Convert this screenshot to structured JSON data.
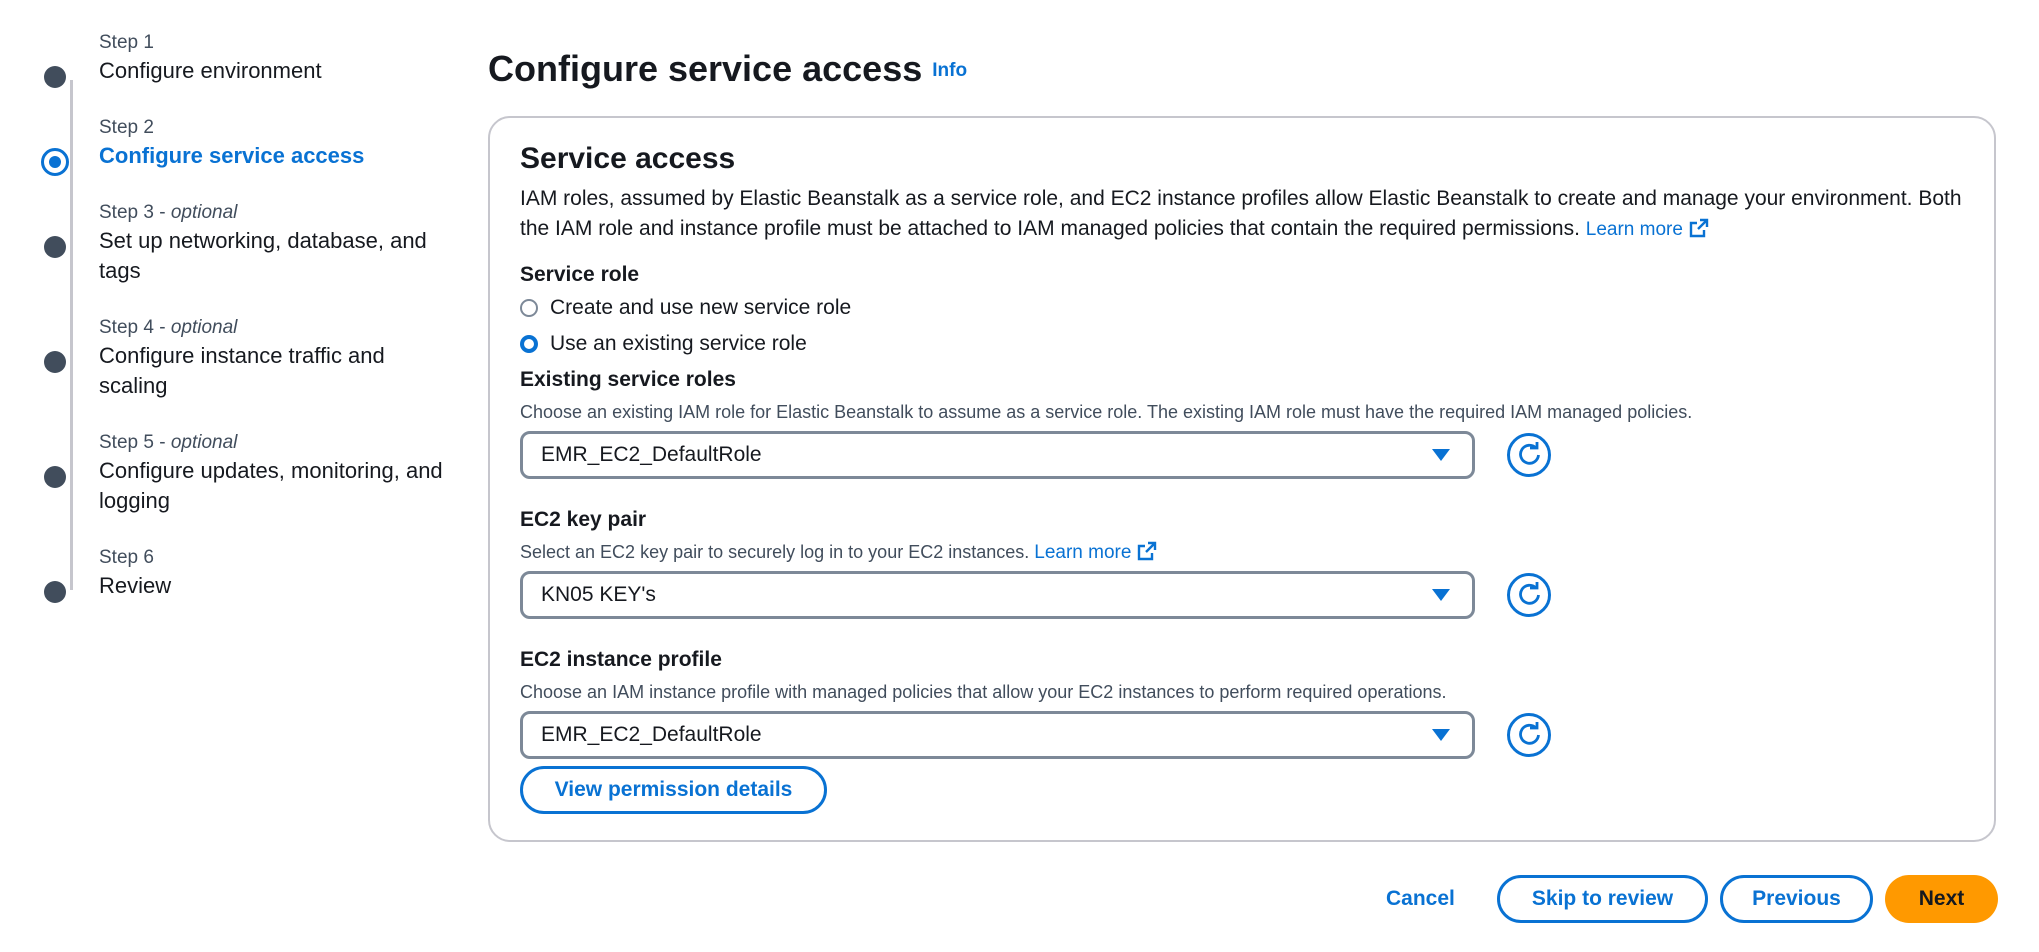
{
  "steps": [
    {
      "small": "Step 1",
      "optional": "",
      "title": "Configure environment",
      "state": "done"
    },
    {
      "small": "Step 2",
      "optional": "",
      "title": "Configure service access",
      "state": "active"
    },
    {
      "small": "Step 3 - ",
      "optional": "optional",
      "title": "Set up networking, database, and tags",
      "state": "pending"
    },
    {
      "small": "Step 4 - ",
      "optional": "optional",
      "title": "Configure instance traffic and scaling",
      "state": "pending"
    },
    {
      "small": "Step 5 - ",
      "optional": "optional",
      "title": "Configure updates, monitoring, and logging",
      "state": "pending"
    },
    {
      "small": "Step 6",
      "optional": "",
      "title": "Review",
      "state": "pending"
    }
  ],
  "page": {
    "title": "Configure service access",
    "info_link": "Info"
  },
  "panel": {
    "heading": "Service access",
    "description": "IAM roles, assumed by Elastic Beanstalk as a service role, and EC2 instance profiles allow Elastic Beanstalk to create and manage your environment. Both the IAM role and instance profile must be attached to IAM managed policies that contain the required permissions.",
    "learn_more": "Learn more",
    "service_role": {
      "label": "Service role",
      "option_new": "Create and use new service role",
      "option_existing": "Use an existing service role",
      "selected": "existing"
    },
    "existing_roles": {
      "label": "Existing service roles",
      "hint": "Choose an existing IAM role for Elastic Beanstalk to assume as a service role. The existing IAM role must have the required IAM managed policies.",
      "value": "EMR_EC2_DefaultRole"
    },
    "key_pair": {
      "label": "EC2 key pair",
      "hint": "Select an EC2 key pair to securely log in to your EC2 instances.",
      "learn_more": "Learn more",
      "value": "KN05 KEY's"
    },
    "instance_profile": {
      "label": "EC2 instance profile",
      "hint": "Choose an IAM instance profile with managed policies that allow your EC2 instances to perform required operations.",
      "value": "EMR_EC2_DefaultRole"
    },
    "view_permissions": "View permission details"
  },
  "footer": {
    "cancel": "Cancel",
    "skip": "Skip to review",
    "previous": "Previous",
    "next": "Next"
  },
  "colors": {
    "accent": "#0972d3",
    "primary_button": "#ff9900",
    "text": "#16191f",
    "muted": "#414d5c"
  }
}
